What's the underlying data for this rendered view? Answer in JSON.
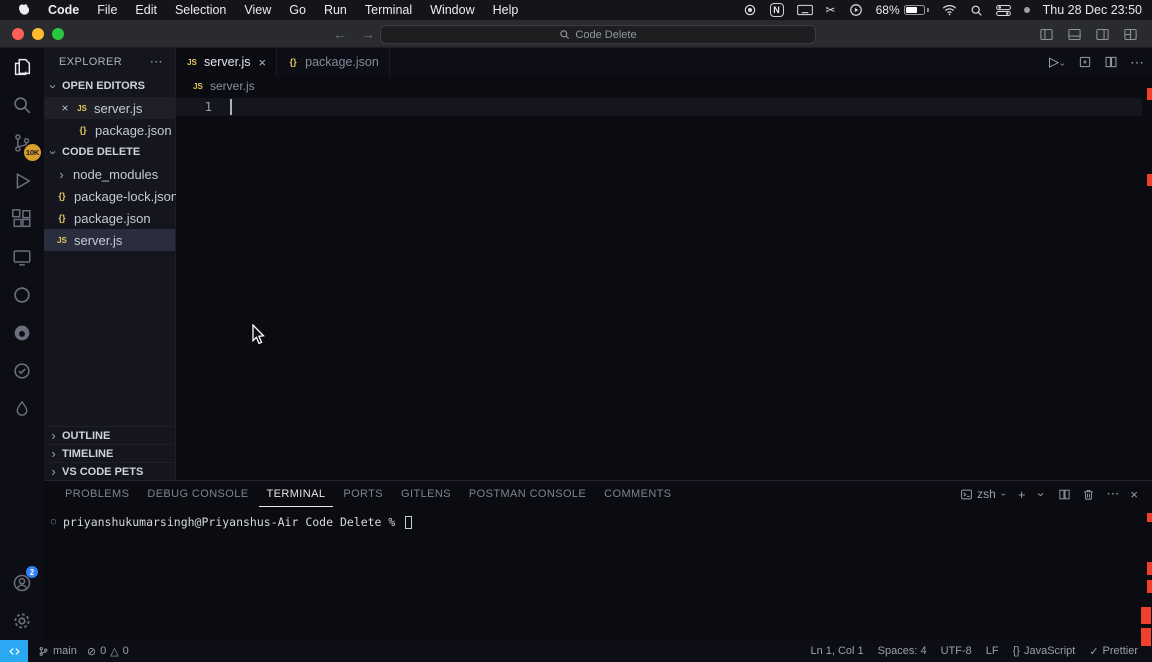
{
  "menubar": {
    "app": "Code",
    "items": [
      "File",
      "Edit",
      "Selection",
      "View",
      "Go",
      "Run",
      "Terminal",
      "Window",
      "Help"
    ],
    "notion": "N",
    "battery_pct": "68%",
    "clock": "Thu 28 Dec 23:50"
  },
  "titlebar": {
    "search": "Code Delete"
  },
  "activitybar": {
    "scm_badge": "10K",
    "account_badge": "2"
  },
  "explorer": {
    "title": "EXPLORER",
    "open_editors": {
      "label": "OPEN EDITORS",
      "items": [
        {
          "name": "server.js"
        },
        {
          "name": "package.json"
        }
      ]
    },
    "workspace": {
      "label": "CODE DELETE",
      "items": [
        {
          "name": "node_modules"
        },
        {
          "name": "package-lock.json"
        },
        {
          "name": "package.json"
        },
        {
          "name": "server.js"
        }
      ]
    },
    "bottom_sections": [
      "OUTLINE",
      "TIMELINE",
      "VS CODE PETS"
    ]
  },
  "editor": {
    "tabs": [
      {
        "name": "server.js"
      },
      {
        "name": "package.json"
      }
    ],
    "breadcrumb": "server.js",
    "line1": "1"
  },
  "panel": {
    "tabs": [
      "PROBLEMS",
      "DEBUG CONSOLE",
      "TERMINAL",
      "PORTS",
      "GITLENS",
      "POSTMAN CONSOLE",
      "COMMENTS"
    ],
    "shell": "zsh",
    "prompt": "priyanshukumarsingh@Priyanshus-Air Code Delete %"
  },
  "statusbar": {
    "branch": "main",
    "errors": "0",
    "warnings": "0",
    "line_col": "Ln 1, Col 1",
    "spaces": "Spaces: 4",
    "encoding": "UTF-8",
    "eol": "LF",
    "language": "JavaScript",
    "prettier": "Prettier"
  },
  "icons": {
    "close": "×",
    "chevron_right": "›",
    "ellipsis": "⋯",
    "js": "JS",
    "json": "{}",
    "play": "▷",
    "plus": "+",
    "scissors": "✂",
    "prompt_circle": "○",
    "error": "⊘",
    "warning": "△",
    "check": "✓",
    "back": "←",
    "forward": "→"
  }
}
